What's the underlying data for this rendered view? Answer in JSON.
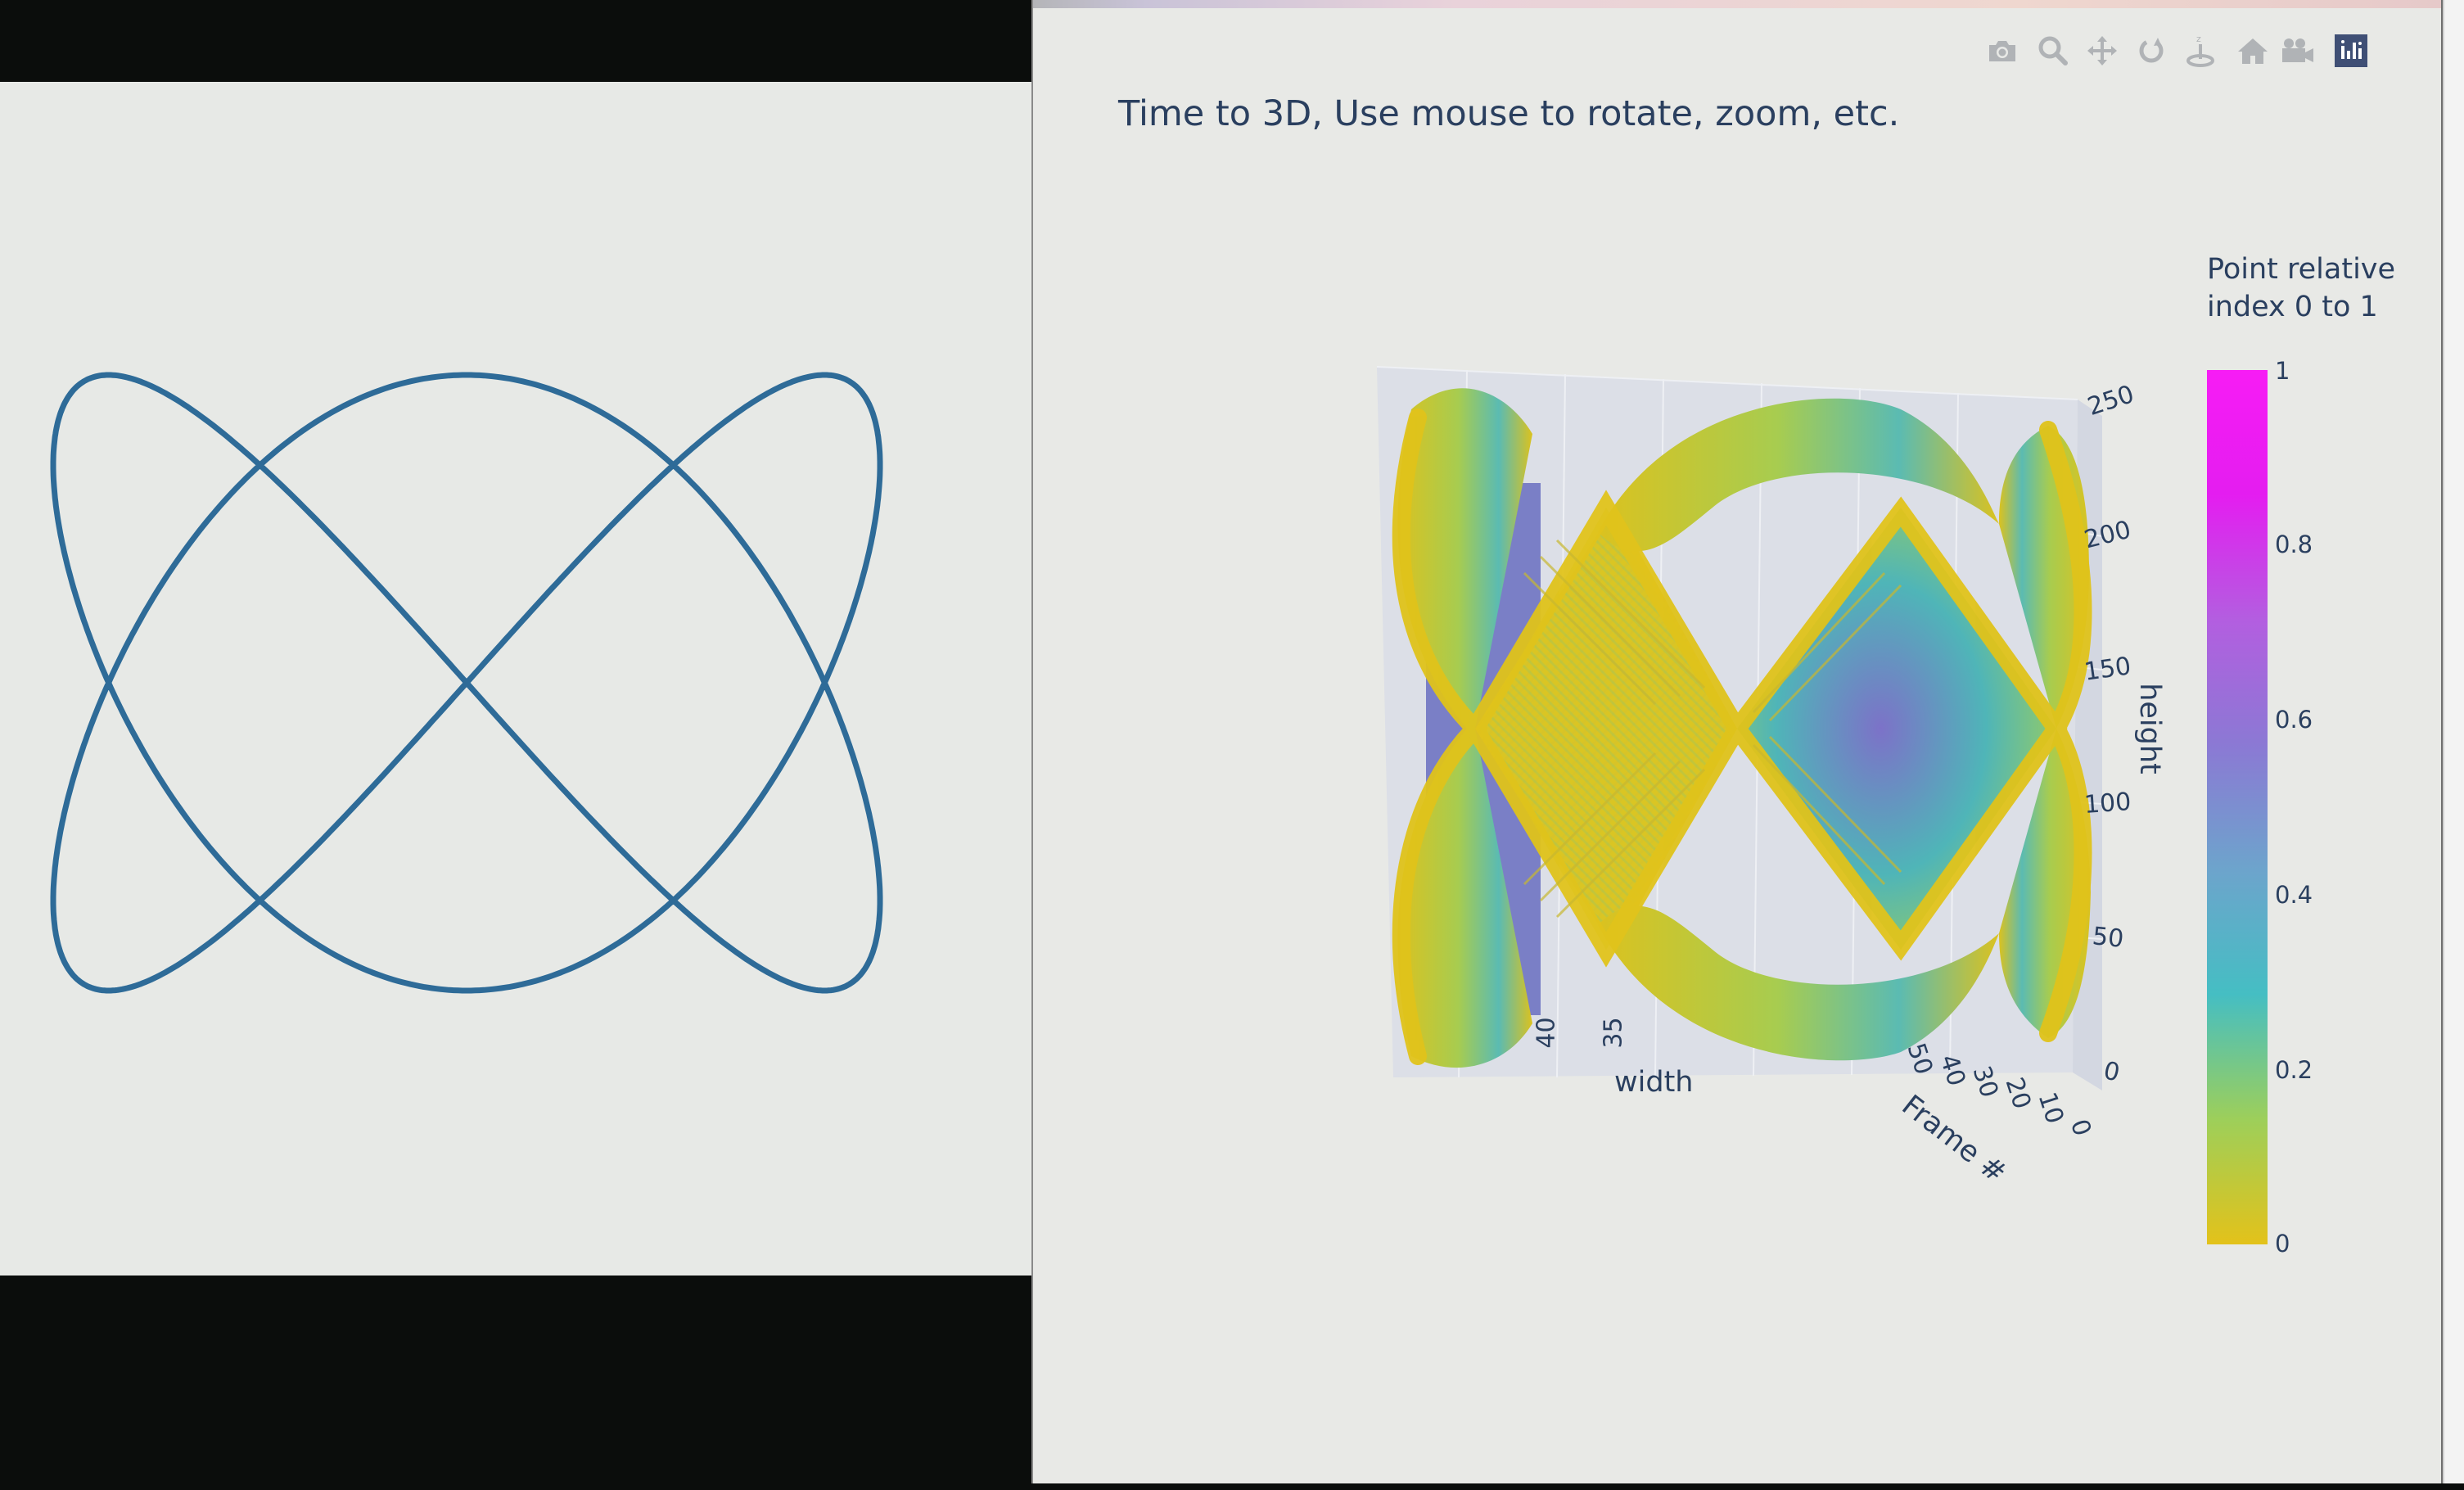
{
  "left_panel": {
    "curve_color": "#2e6b98"
  },
  "modebar": {
    "buttons": [
      {
        "name": "camera-icon",
        "title": "Download plot as a png"
      },
      {
        "name": "zoom-icon",
        "title": "Zoom"
      },
      {
        "name": "pan-icon",
        "title": "Pan"
      },
      {
        "name": "orbit-rotation-icon",
        "title": "Orbital rotation"
      },
      {
        "name": "turntable-rotation-icon",
        "title": "Turntable rotation"
      },
      {
        "name": "home-icon",
        "title": "Reset camera to default"
      },
      {
        "name": "last-save-camera-icon",
        "title": "Reset camera to last save"
      },
      {
        "name": "plotly-logo-icon",
        "title": "Produced with Plotly"
      }
    ]
  },
  "plot": {
    "title": "Time to 3D, Use mouse to rotate, zoom, etc.",
    "text_color": "#2a3f5f"
  },
  "chart_data": {
    "type": "scatter3d",
    "title": "Time to 3D, Use mouse to rotate, zoom, etc.",
    "axes": {
      "x": {
        "label": "width",
        "visible_ticks": [
          "40",
          "35"
        ]
      },
      "y": {
        "label": "Frame #",
        "visible_ticks": [
          "50",
          "40",
          "30",
          "20",
          "10",
          "0"
        ]
      },
      "z": {
        "label": "height",
        "ticks": [
          "0",
          "50",
          "100",
          "150",
          "200",
          "250"
        ],
        "range": [
          0,
          250
        ]
      }
    },
    "colorbar": {
      "title": "Point relative index 0 to 1",
      "ticks": [
        "0",
        "0.2",
        "0.4",
        "0.6",
        "0.8",
        "1"
      ],
      "range": [
        0,
        1
      ],
      "colorscale": [
        "#e3c21a",
        "#9dcf5a",
        "#45bec3",
        "#6da4cc",
        "#8b79d4",
        "#b35ee0",
        "#e41df0",
        "#f71cf5"
      ]
    },
    "surface_colors": {
      "edge": "#dcc21e",
      "mid": "#4fb5b8",
      "core": "#7c72c8"
    }
  }
}
